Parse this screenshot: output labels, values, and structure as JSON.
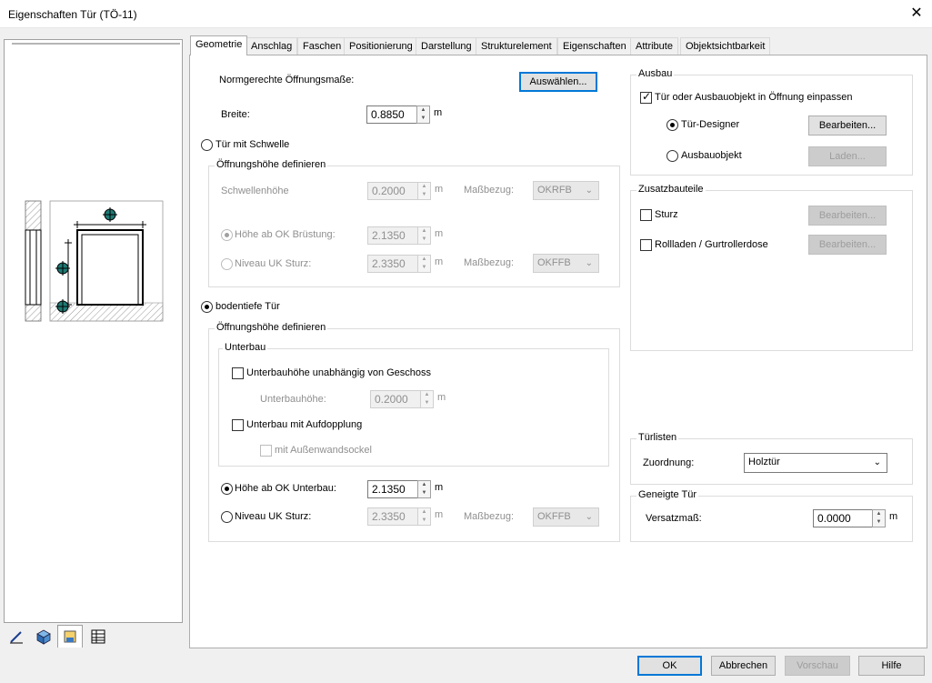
{
  "window": {
    "title": "Eigenschaften Tür (TÖ-11)"
  },
  "tabs": [
    "Geometrie",
    "Anschlag",
    "Faschen",
    "Positionierung",
    "Darstellung",
    "Strukturelement",
    "Eigenschaften",
    "Attribute",
    "Objektsichtbarkeit"
  ],
  "geometry": {
    "norm_label": "Normgerechte Öffnungsmaße:",
    "select_button": "Auswählen...",
    "width_label": "Breite:",
    "width_value": "0.8850",
    "unit": "m",
    "threshold_radio": "Tür mit Schwelle",
    "threshold_group": {
      "title": "Öffnungshöhe definieren",
      "sill_height_label": "Schwellenhöhe",
      "sill_height_value": "0.2000",
      "reference_label": "Maßbezug:",
      "reference_value_1": "OKRFB",
      "height_parapet_label": "Höhe ab OK Brüstung:",
      "height_parapet_value": "2.1350",
      "lintel_label": "Niveau UK Sturz:",
      "lintel_value": "2.3350",
      "reference_value_2": "OKFFB"
    },
    "floor_radio": "bodentiefe Tür",
    "floor_group": {
      "title": "Öffnungshöhe definieren",
      "substructure_title": "Unterbau",
      "independent_label": "Unterbauhöhe unabhängig von Geschoss",
      "sub_height_label": "Unterbauhöhe:",
      "sub_height_value": "0.2000",
      "doubling_label": "Unterbau mit Aufdopplung",
      "base_label": "mit Außenwandsockel",
      "height_sub_label": "Höhe ab OK Unterbau:",
      "height_sub_value": "2.1350",
      "lintel_label": "Niveau UK Sturz:",
      "lintel_value": "2.3350",
      "reference_label": "Maßbezug:",
      "reference_value": "OKFFB"
    }
  },
  "ausbau": {
    "title": "Ausbau",
    "fit_label": "Tür oder Ausbauobjekt in Öffnung einpassen",
    "designer_label": "Tür-Designer",
    "edit_button": "Bearbeiten...",
    "object_label": "Ausbauobjekt",
    "load_button": "Laden..."
  },
  "zusatz": {
    "title": "Zusatzbauteile",
    "lintel_label": "Sturz",
    "lintel_button": "Bearbeiten...",
    "shutter_label": "Rollladen / Gurtrollerdose",
    "shutter_button": "Bearbeiten..."
  },
  "tuerlisten": {
    "title": "Türlisten",
    "assign_label": "Zuordnung:",
    "assign_value": "Holztür"
  },
  "geneigt": {
    "title": "Geneigte Tür",
    "offset_label": "Versatzmaß:",
    "offset_value": "0.0000"
  },
  "footer": {
    "ok": "OK",
    "cancel": "Abbrechen",
    "preview": "Vorschau",
    "help": "Hilfe"
  },
  "colors": {
    "accent": "#0078d7",
    "marker": "#1e7a75"
  },
  "icons": [
    "pencil-icon",
    "3d-cube-icon",
    "material-icon",
    "table-icon"
  ]
}
